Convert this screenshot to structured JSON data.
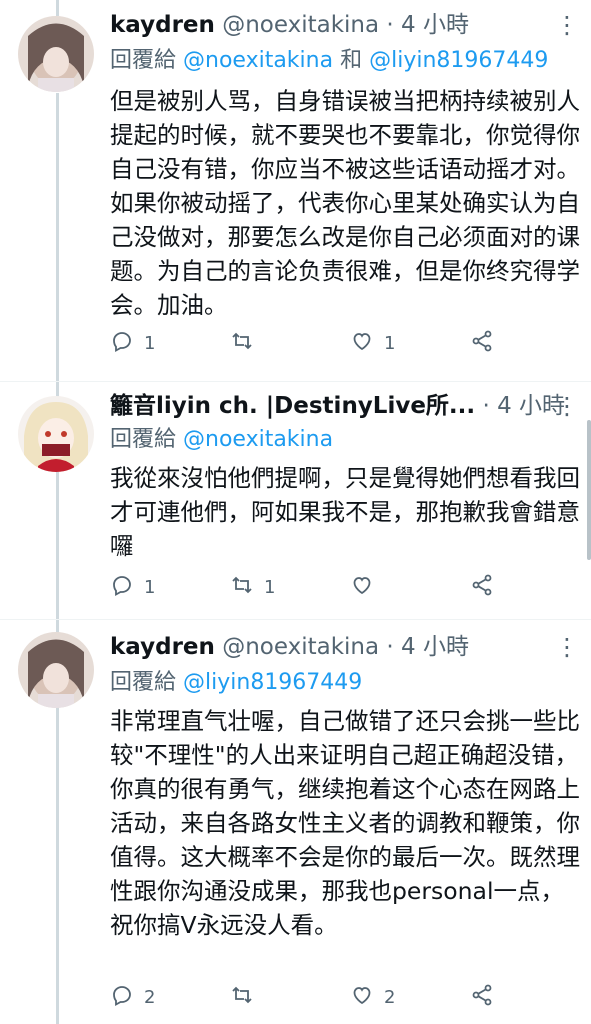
{
  "tweets": [
    {
      "name": "kaydren",
      "handle": "@noexitakina",
      "dot": "·",
      "time": "4 小時",
      "reply_prefix": "回覆給",
      "reply_mentions": [
        "@noexitakina",
        "和",
        "@liyin81967449"
      ],
      "body": "但是被别人骂，自身错误被当把柄持续被别人提起的时候，就不要哭也不要靠北，你觉得你自己没有错，你应当不被这些话语动摇才对。如果你被动摇了，代表你心里某处确实认为自己没做对，那要怎么改是你自己必须面对的课题。为自己的言论负责很难，但是你终究得学会。加油。",
      "counts": {
        "reply": "1",
        "retweet": "",
        "like": "1"
      }
    },
    {
      "name": "籬音liyin ch. |DestinyLive所...",
      "handle": "",
      "dot": "·",
      "time": "4 小時",
      "reply_prefix": "回覆給",
      "reply_mentions": [
        "@noexitakina"
      ],
      "body": "我從來沒怕他們提啊，只是覺得她們想看我回才可連他們，阿如果我不是，那抱歉我會錯意囉",
      "counts": {
        "reply": "1",
        "retweet": "1",
        "like": ""
      }
    },
    {
      "name": "kaydren",
      "handle": "@noexitakina",
      "dot": "·",
      "time": "4 小時",
      "reply_prefix": "回覆給",
      "reply_mentions": [
        "@liyin81967449"
      ],
      "body": "非常理直气壮喔，自己做错了还只会挑一些比较\"不理性\"的人出来证明自己超正确超没错，你真的很有勇气，继续抱着这个心态在网路上活动，来自各路女性主义者的调教和鞭策，你值得。这大概率不会是你的最后一次。既然理性跟你沟通没成果，那我也personal一点，祝你搞V永远没人看。",
      "counts": {
        "reply": "2",
        "retweet": "",
        "like": "2"
      }
    }
  ],
  "icons": {
    "reply": "reply-icon",
    "retweet": "retweet-icon",
    "like": "heart-icon",
    "share": "share-icon",
    "more": "more-icon"
  },
  "colors": {
    "text": "#0f1419",
    "secondary": "#536471",
    "mention": "#1d9bf0"
  }
}
